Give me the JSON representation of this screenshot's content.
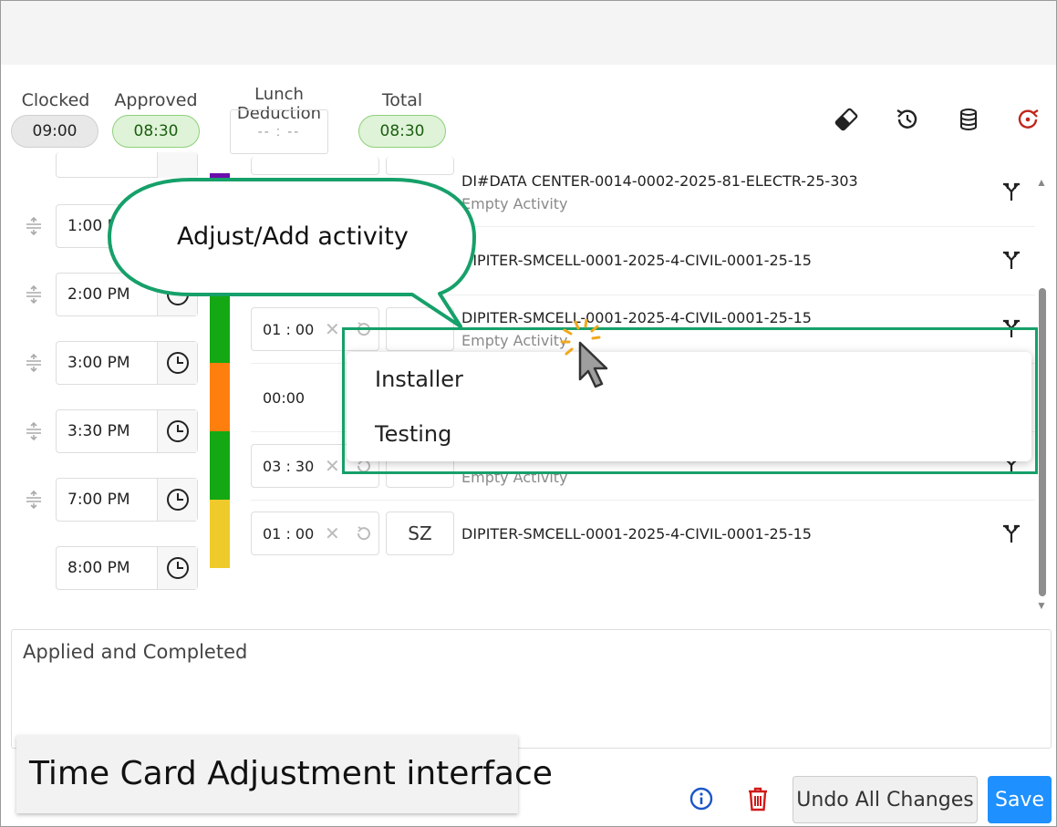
{
  "summary": {
    "clocked_label": "Clocked",
    "clocked_value": "09:00",
    "approved_label": "Approved",
    "approved_value": "08:30",
    "lunch_label": "Lunch Deduction",
    "lunch_placeholder": "-- : --",
    "total_label": "Total",
    "total_value": "08:30"
  },
  "toolbar_icons": [
    "eraser-icon",
    "history-icon",
    "database-icon",
    "reset-icon"
  ],
  "time_slots": [
    {
      "time": "1:00 PM"
    },
    {
      "time": "2:00 PM"
    },
    {
      "time": "3:00 PM"
    },
    {
      "time": "3:30 PM"
    },
    {
      "time": "7:00 PM"
    },
    {
      "time": "8:00 PM"
    }
  ],
  "entries": [
    {
      "job": "DI#DATA CENTER-0014-0002-2025-81-ELECTR-25-303",
      "activity": "Empty Activity"
    },
    {
      "job": "DIPITER-SMCELL-0001-2025-4-CIVIL-0001-25-15"
    },
    {
      "duration_h": "01",
      "duration_m": "00",
      "job": "DIPITER-SMCELL-0001-2025-4-CIVIL-0001-25-15",
      "activity": "Empty Activity"
    },
    {
      "duration": "00:00"
    },
    {
      "duration_h": "03",
      "duration_m": "30",
      "activity": "Empty Activity"
    },
    {
      "duration_h": "01",
      "duration_m": "00",
      "code": "SZ",
      "job": "DIPITER-SMCELL-0001-2025-4-CIVIL-0001-25-15"
    }
  ],
  "colors": {
    "purple": "#6a0dad",
    "green": "#14a814",
    "orange": "#ff7f0e",
    "yellow": "#eecb2a",
    "accent": "#1e90ff",
    "highlight": "#16a06a"
  },
  "dropdown": {
    "options": [
      "Installer",
      "Testing"
    ]
  },
  "callout": {
    "text": "Adjust/Add activity"
  },
  "notes": {
    "text": "Applied and Completed"
  },
  "caption": {
    "text": "Time Card Adjustment interface"
  },
  "footer": {
    "undo_label": "Undo All Changes",
    "save_label": "Save"
  }
}
